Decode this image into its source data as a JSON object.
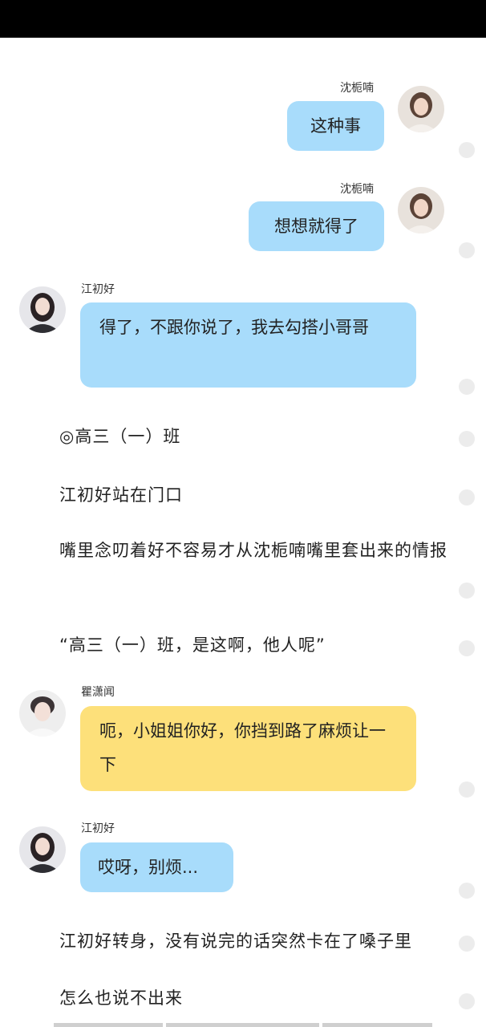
{
  "messages": [
    {
      "speaker": "沈栀喃",
      "text": "这种事",
      "side": "right",
      "color": "blue"
    },
    {
      "speaker": "沈栀喃",
      "text": "想想就得了",
      "side": "right",
      "color": "blue"
    },
    {
      "speaker": "江初好",
      "text": "得了，不跟你说了，我去勾搭小哥哥",
      "side": "left",
      "color": "blue"
    },
    {
      "speaker": "瞿潇闻",
      "text": "呃，小姐姐你好，你挡到路了麻烦让一下",
      "side": "left",
      "color": "yellow"
    },
    {
      "speaker": "江初好",
      "text": "哎呀，别烦...",
      "side": "left",
      "color": "blue"
    }
  ],
  "narration": [
    "◎高三（一）班",
    "江初好站在门口",
    "嘴里念叨着好不容易才从沈栀喃嘴里套出来的情报",
    "“高三（一）班，是这啊，他人呢”",
    "江初好转身，没有说完的话突然卡在了嗓子里",
    "怎么也说不出来"
  ],
  "colors": {
    "blue_bubble": "#a8dcfb",
    "yellow_bubble": "#fde07a",
    "background": "#ffffff"
  }
}
